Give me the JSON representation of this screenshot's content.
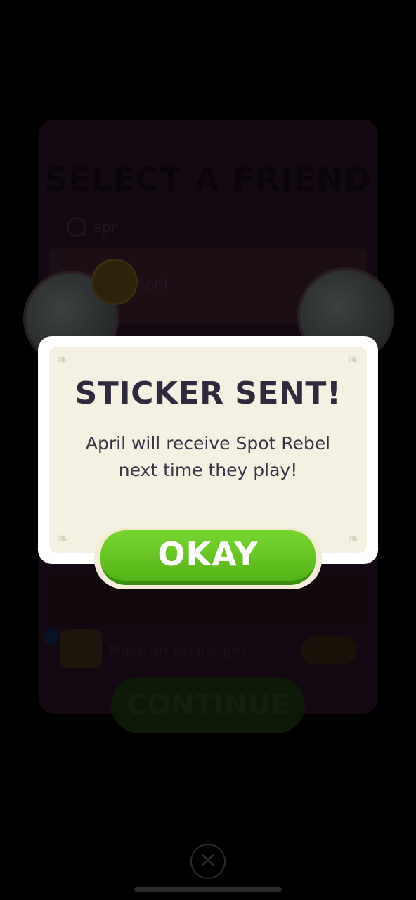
{
  "background": {
    "title": "SELECT A FRIEND",
    "search_value": "apr",
    "friend_name": "April",
    "exchange_label": "Make an exchange!",
    "continue_label": "CONTINUE"
  },
  "dialog": {
    "title": "STICKER SENT!",
    "message": "April will receive Spot Rebel next time they play!",
    "okay_label": "OKAY"
  },
  "icons": {
    "close": "close-icon",
    "search": "search-icon",
    "corner": "corner-ornament-icon"
  },
  "colors": {
    "accent_green": "#5cc11f",
    "title_text": "#2f2b3e",
    "dialog_bg": "#f4f1e3"
  }
}
